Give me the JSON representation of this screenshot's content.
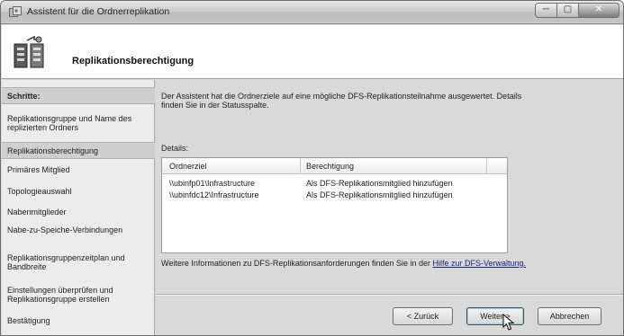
{
  "window": {
    "title": "Assistent für die Ordnerreplikation",
    "buttons": {
      "minimize": "─",
      "maximize": "▢",
      "close": "✕"
    }
  },
  "header": {
    "title": "Replikationsberechtigung",
    "icon": "replication-wizard-icon"
  },
  "steps": {
    "heading": "Schritte:",
    "items": [
      {
        "label": "Replikationsgruppe und Name des replizierten Ordners"
      },
      {
        "label": "Replikationsberechtigung",
        "active": true
      },
      {
        "label": "Primäres Mitglied"
      },
      {
        "label": "Topologieauswahl"
      },
      {
        "label": "Nabenmitglieder"
      },
      {
        "label": "Nabe-zu-Speiche-Verbindungen"
      },
      {
        "label": "Replikationsgruppenzeitplan und Bandbreite"
      },
      {
        "label": "Einstellungen überprüfen und Replikationsgruppe erstellen"
      },
      {
        "label": "Bestätigung"
      }
    ]
  },
  "main": {
    "intro": "Der Assistent hat die Ordnerziele auf eine mögliche DFS-Replikationsteilnahme ausgewertet. Details finden Sie in der Statusspalte.",
    "details_label": "Details:",
    "table": {
      "columns": [
        "Ordnerziel",
        "Berechtigung"
      ],
      "rows": [
        [
          "\\\\ubinfp01\\Infrastructure",
          "Als DFS-Replikationsmitglied hinzufügen"
        ],
        [
          "\\\\ubinfdc12\\Infrastructure",
          "Als DFS-Replikationsmitglied hinzufügen"
        ]
      ]
    },
    "info_text": "Weitere Informationen zu DFS-Replikationsanforderungen finden Sie in der",
    "info_link": "Hilfe zur DFS-Verwaltung."
  },
  "buttons": {
    "back": "< Zurück",
    "next": "Weiter >",
    "cancel": "Abbrechen"
  },
  "colors": {
    "link": "#1a1a7a",
    "active_step": "#cfcfcf"
  }
}
